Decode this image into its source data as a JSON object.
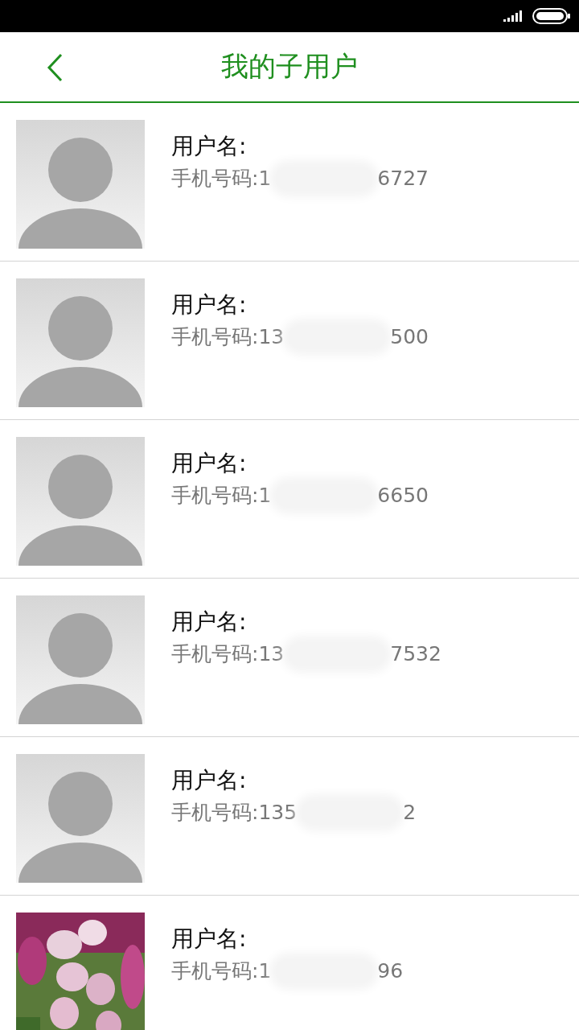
{
  "header": {
    "title": "我的子用户"
  },
  "users": [
    {
      "kind": "default",
      "name_label": "用户名:",
      "phone_label": "手机号码:",
      "phone_head": "1",
      "phone_tail": "6727"
    },
    {
      "kind": "default",
      "name_label": "用户名:",
      "phone_label": "手机号码:",
      "phone_head": "13",
      "phone_tail": "500"
    },
    {
      "kind": "default",
      "name_label": "用户名:",
      "phone_label": "手机号码:",
      "phone_head": "1",
      "phone_tail": "6650"
    },
    {
      "kind": "default",
      "name_label": "用户名:",
      "phone_label": "手机号码:",
      "phone_head": "13",
      "phone_tail": "7532"
    },
    {
      "kind": "default",
      "name_label": "用户名:",
      "phone_label": "手机号码:",
      "phone_head": "135",
      "phone_tail": "2"
    },
    {
      "kind": "picture",
      "name_label": "用户名:",
      "phone_label": "手机号码:",
      "phone_head": "1",
      "phone_tail": "96"
    }
  ]
}
